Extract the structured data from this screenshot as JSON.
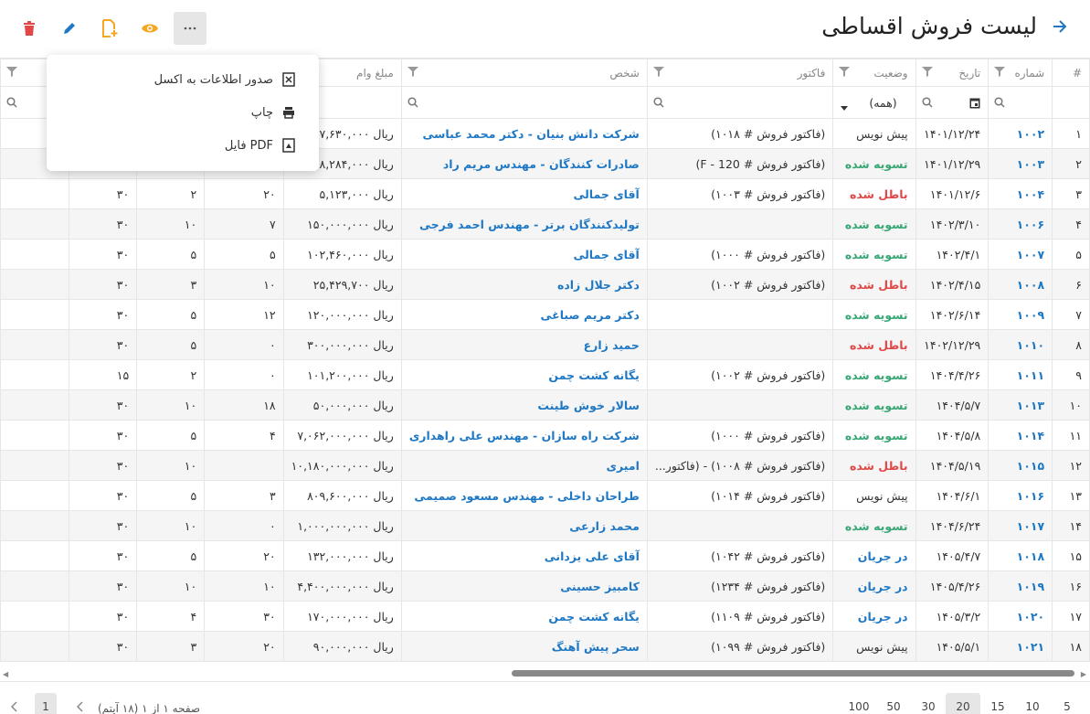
{
  "header": {
    "title": "لیست فروش اقساطی"
  },
  "icons": {
    "back": "arrow-right-icon",
    "delete": "trash-icon",
    "edit": "pencil-icon",
    "add": "add-file-icon",
    "view": "eye-icon",
    "more": "more-icon"
  },
  "colors": {
    "link": "#1f78c4",
    "settled": "#3aa876",
    "void": "#e04848",
    "delete": "#e04848",
    "add": "#f5a623"
  },
  "menu": {
    "items": [
      {
        "label": "صدور اطلاعات به اکسل",
        "icon": "excel-icon"
      },
      {
        "label": "چاپ",
        "icon": "print-icon"
      },
      {
        "label": "فایل PDF",
        "icon": "pdf-icon"
      }
    ]
  },
  "columns": [
    "#",
    "شماره",
    "تاریخ",
    "وضعیت",
    "فاکتور",
    "شخص",
    "مبلغ وام",
    "",
    "",
    "",
    "انی"
  ],
  "filters": {
    "status_value": "(همه)"
  },
  "rows": [
    {
      "i": "۱",
      "no": "۱۰۰۲",
      "date": "۱۴۰۱/۱۲/۲۴",
      "status": "پیش نویس",
      "st": "pish",
      "inv": "(فاکتور فروش # ۱۰۱۸)",
      "person": "شرکت دانش بنیان - دکتر محمد عباسی",
      "amount": "ریال ۷,۶۳۰,۰۰۰",
      "c8": "",
      "c9": "",
      "c10": ""
    },
    {
      "i": "۲",
      "no": "۱۰۰۳",
      "date": "۱۴۰۱/۱۲/۲۹",
      "status": "تسویه شده",
      "st": "tas",
      "inv": "(فاکتور فروش # 120 - F)",
      "person": "صادرات کنندگان - مهندس مریم راد",
      "amount": "ریال ۸,۲۸۴,۰۰۰",
      "c8": "",
      "c9": "",
      "c10": ""
    },
    {
      "i": "۳",
      "no": "۱۰۰۴",
      "date": "۱۴۰۱/۱۲/۶",
      "status": "باطل شده",
      "st": "bat",
      "inv": "(فاکتور فروش # ۱۰۰۳)",
      "person": "آقای جمالی",
      "amount": "ریال ۵,۱۲۳,۰۰۰",
      "c8": "۲۰",
      "c9": "۲",
      "c10": "۳۰"
    },
    {
      "i": "۴",
      "no": "۱۰۰۶",
      "date": "۱۴۰۲/۳/۱۰",
      "status": "تسویه شده",
      "st": "tas",
      "inv": "",
      "person": "تولیدکنندگان برتر - مهندس احمد فرجی",
      "amount": "ریال ۱۵۰,۰۰۰,۰۰۰",
      "c8": "۷",
      "c9": "۱۰",
      "c10": "۳۰"
    },
    {
      "i": "۵",
      "no": "۱۰۰۷",
      "date": "۱۴۰۲/۴/۱",
      "status": "تسویه شده",
      "st": "tas",
      "inv": "(فاکتور فروش # ۱۰۰۰)",
      "person": "آقای جمالی",
      "amount": "ریال ۱۰۲,۴۶۰,۰۰۰",
      "c8": "۵",
      "c9": "۵",
      "c10": "۳۰"
    },
    {
      "i": "۶",
      "no": "۱۰۰۸",
      "date": "۱۴۰۲/۴/۱۵",
      "status": "باطل شده",
      "st": "bat",
      "inv": "(فاکتور فروش # ۱۰۰۲)",
      "person": "دکتر جلال زاده",
      "amount": "ریال ۲۵,۴۲۹,۷۰۰",
      "c8": "۱۰",
      "c9": "۳",
      "c10": "۳۰"
    },
    {
      "i": "۷",
      "no": "۱۰۰۹",
      "date": "۱۴۰۲/۶/۱۴",
      "status": "تسویه شده",
      "st": "tas",
      "inv": "",
      "person": "دکتر مریم صباغی",
      "amount": "ریال ۱۲۰,۰۰۰,۰۰۰",
      "c8": "۱۲",
      "c9": "۵",
      "c10": "۳۰"
    },
    {
      "i": "۸",
      "no": "۱۰۱۰",
      "date": "۱۴۰۲/۱۲/۲۹",
      "status": "باطل شده",
      "st": "bat",
      "inv": "",
      "person": "حمید زارع",
      "amount": "ریال ۳۰۰,۰۰۰,۰۰۰",
      "c8": "۰",
      "c9": "۵",
      "c10": "۳۰"
    },
    {
      "i": "۹",
      "no": "۱۰۱۱",
      "date": "۱۴۰۴/۴/۲۶",
      "status": "تسویه شده",
      "st": "tas",
      "inv": "(فاکتور فروش # ۱۰۰۲)",
      "person": "یگانه کشت چمن",
      "amount": "ریال ۱۰۱,۲۰۰,۰۰۰",
      "c8": "۰",
      "c9": "۲",
      "c10": "۱۵"
    },
    {
      "i": "۱۰",
      "no": "۱۰۱۳",
      "date": "۱۴۰۴/۵/۷",
      "status": "تسویه شده",
      "st": "tas",
      "inv": "",
      "person": "سالار خوش طینت",
      "amount": "ریال ۵۰,۰۰۰,۰۰۰",
      "c8": "۱۸",
      "c9": "۱۰",
      "c10": "۳۰"
    },
    {
      "i": "۱۱",
      "no": "۱۰۱۴",
      "date": "۱۴۰۴/۵/۸",
      "status": "تسویه شده",
      "st": "tas",
      "inv": "(فاکتور فروش # ۱۰۰۰)",
      "person": "شرکت راه سازان - مهندس علی راهداری",
      "amount": "ریال ۷,۰۶۲,۰۰۰,۰۰۰",
      "c8": "۴",
      "c9": "۵",
      "c10": "۳۰"
    },
    {
      "i": "۱۲",
      "no": "۱۰۱۵",
      "date": "۱۴۰۴/۵/۱۹",
      "status": "باطل شده",
      "st": "bat",
      "inv": "(فاکتور فروش # ۱۰۰۸) - (فاکتور...",
      "person": "امیری",
      "amount": "ریال ۱۰,۱۸۰,۰۰۰,۰۰۰",
      "c8": "",
      "c9": "۱۰",
      "c10": "۳۰"
    },
    {
      "i": "۱۳",
      "no": "۱۰۱۶",
      "date": "۱۴۰۴/۶/۱",
      "status": "پیش نویس",
      "st": "pish",
      "inv": "(فاکتور فروش # ۱۰۱۴)",
      "person": "طراحان داخلی - مهندس مسعود صمیمی",
      "amount": "ریال ۸۰۹,۶۰۰,۰۰۰",
      "c8": "۳",
      "c9": "۵",
      "c10": "۳۰"
    },
    {
      "i": "۱۴",
      "no": "۱۰۱۷",
      "date": "۱۴۰۴/۶/۲۴",
      "status": "تسویه شده",
      "st": "tas",
      "inv": "",
      "person": "محمد زارعی",
      "amount": "ریال ۱,۰۰۰,۰۰۰,۰۰۰",
      "c8": "۰",
      "c9": "۱۰",
      "c10": "۳۰"
    },
    {
      "i": "۱۵",
      "no": "۱۰۱۸",
      "date": "۱۴۰۵/۴/۷",
      "status": "در جریان",
      "st": "jar",
      "inv": "(فاکتور فروش # ۱۰۴۲)",
      "person": "آقای علی یزدانی",
      "amount": "ریال ۱۳۲,۰۰۰,۰۰۰",
      "c8": "۲۰",
      "c9": "۵",
      "c10": "۳۰"
    },
    {
      "i": "۱۶",
      "no": "۱۰۱۹",
      "date": "۱۴۰۵/۴/۲۶",
      "status": "در جریان",
      "st": "jar",
      "inv": "(فاکتور فروش # ۱۲۳۴)",
      "person": "کامبیز حسینی",
      "amount": "ریال ۴,۴۰۰,۰۰۰,۰۰۰",
      "c8": "۱۰",
      "c9": "۱۰",
      "c10": "۳۰"
    },
    {
      "i": "۱۷",
      "no": "۱۰۲۰",
      "date": "۱۴۰۵/۳/۲",
      "status": "در جریان",
      "st": "jar",
      "inv": "(فاکتور فروش # ۱۱۰۹)",
      "person": "یگانه کشت چمن",
      "amount": "ریال ۱۷۰,۰۰۰,۰۰۰",
      "c8": "۳۰",
      "c9": "۴",
      "c10": "۳۰"
    },
    {
      "i": "۱۸",
      "no": "۱۰۲۱",
      "date": "۱۴۰۵/۵/۱",
      "status": "پیش نویس",
      "st": "pish",
      "inv": "(فاکتور فروش # ۱۰۹۹)",
      "person": "سحر پیش آهنگ",
      "amount": "ریال ۹۰,۰۰۰,۰۰۰",
      "c8": "۲۰",
      "c9": "۳",
      "c10": "۳۰"
    }
  ],
  "pager": {
    "sizes": [
      "5",
      "10",
      "15",
      "20",
      "30",
      "50",
      "100"
    ],
    "selected_size": "20",
    "info": "صفحه ۱ از ۱ (۱۸ آیتم)",
    "current_page": "1"
  }
}
